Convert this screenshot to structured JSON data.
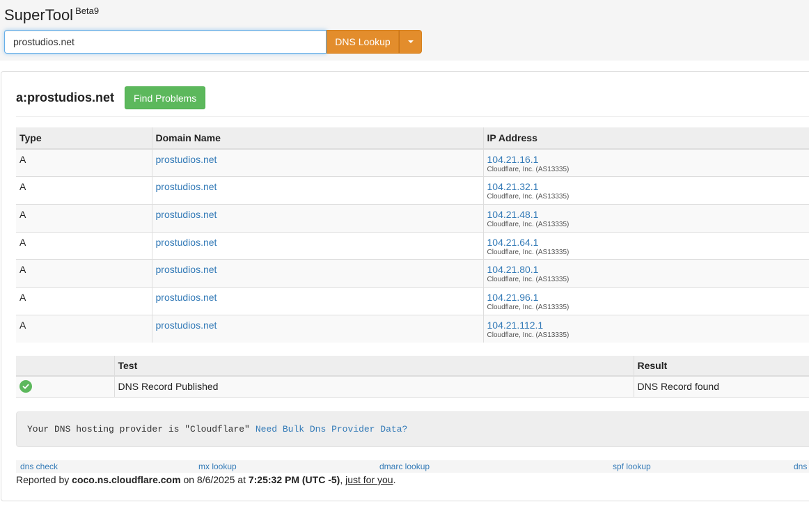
{
  "header": {
    "brand": "SuperTool",
    "brand_sup": "Beta9"
  },
  "search": {
    "value": "prostudios.net",
    "button_label": "DNS Lookup"
  },
  "result": {
    "title": "a:prostudios.net",
    "find_button": "Find Problems"
  },
  "records": {
    "columns": [
      "Type",
      "Domain Name",
      "IP Address"
    ],
    "rows": [
      {
        "type": "A",
        "domain": "prostudios.net",
        "ip": "104.21.16.1",
        "owner": "Cloudflare, Inc. (AS13335)"
      },
      {
        "type": "A",
        "domain": "prostudios.net",
        "ip": "104.21.32.1",
        "owner": "Cloudflare, Inc. (AS13335)"
      },
      {
        "type": "A",
        "domain": "prostudios.net",
        "ip": "104.21.48.1",
        "owner": "Cloudflare, Inc. (AS13335)"
      },
      {
        "type": "A",
        "domain": "prostudios.net",
        "ip": "104.21.64.1",
        "owner": "Cloudflare, Inc. (AS13335)"
      },
      {
        "type": "A",
        "domain": "prostudios.net",
        "ip": "104.21.80.1",
        "owner": "Cloudflare, Inc. (AS13335)"
      },
      {
        "type": "A",
        "domain": "prostudios.net",
        "ip": "104.21.96.1",
        "owner": "Cloudflare, Inc. (AS13335)"
      },
      {
        "type": "A",
        "domain": "prostudios.net",
        "ip": "104.21.112.1",
        "owner": "Cloudflare, Inc. (AS13335)"
      }
    ]
  },
  "tests": {
    "columns": [
      "",
      "Test",
      "Result"
    ],
    "rows": [
      {
        "status_icon": "check-circle-icon",
        "test": "DNS Record Published",
        "result": "DNS Record found"
      }
    ]
  },
  "provider": {
    "text": "Your DNS hosting provider is \"Cloudflare\"",
    "link": "Need Bulk Dns Provider Data?"
  },
  "footer": {
    "links": [
      "dns check",
      "mx lookup",
      "dmarc lookup",
      "spf lookup",
      "dns l"
    ],
    "reported_prefix": "Reported by",
    "server": "coco.ns.cloudflare.com",
    "on_text": "on 8/6/2025 at",
    "time": "7:25:32 PM (UTC -5)",
    "comma": ",",
    "just_for_you": "just for you",
    "period": "."
  },
  "colors": {
    "accent_orange": "#e38d2c",
    "success_green": "#5cb85c",
    "link_blue": "#337ab7"
  }
}
